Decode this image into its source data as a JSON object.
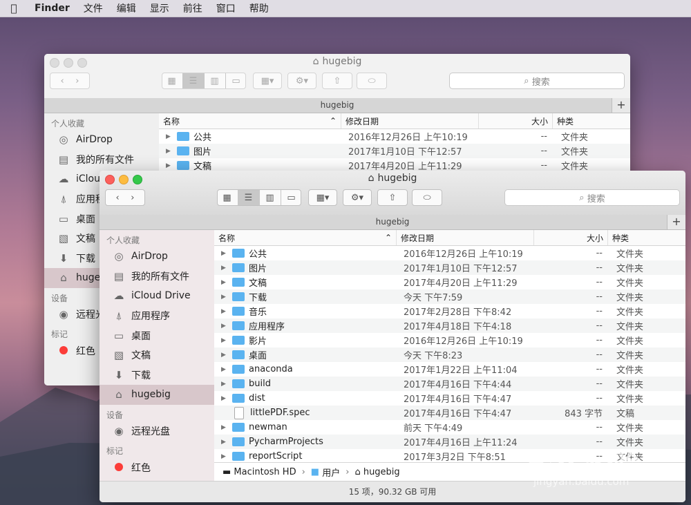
{
  "menubar": {
    "app": "Finder",
    "items": [
      "文件",
      "编辑",
      "显示",
      "前往",
      "窗口",
      "帮助"
    ]
  },
  "window": {
    "title": "hugebig",
    "path_tab": "hugebig",
    "search_placeholder": "搜索",
    "sidebar": {
      "favorites_header": "个人收藏",
      "favorites": [
        {
          "label": "AirDrop",
          "icon": "airdrop-icon"
        },
        {
          "label": "我的所有文件",
          "icon": "all-files-icon"
        },
        {
          "label": "iCloud Drive",
          "icon": "cloud-icon"
        },
        {
          "label": "应用程序",
          "icon": "applications-icon"
        },
        {
          "label": "桌面",
          "icon": "desktop-icon"
        },
        {
          "label": "文稿",
          "icon": "documents-icon"
        },
        {
          "label": "下载",
          "icon": "download-icon"
        },
        {
          "label": "hugebig",
          "icon": "home-icon"
        }
      ],
      "devices_header": "设备",
      "devices": [
        {
          "label": "远程光盘",
          "icon": "disc-icon"
        }
      ],
      "tags_header": "标记",
      "tags": [
        {
          "label": "红色",
          "color": "#fc3d39"
        }
      ]
    },
    "columns": {
      "name": "名称",
      "date": "修改日期",
      "size": "大小",
      "kind": "种类"
    },
    "rows": [
      {
        "name": "公共",
        "date": "2016年12月26日 上午10:19",
        "size": "--",
        "kind": "文件夹"
      },
      {
        "name": "图片",
        "date": "2017年1月10日 下午12:57",
        "size": "--",
        "kind": "文件夹"
      },
      {
        "name": "文稿",
        "date": "2017年4月20日 上午11:29",
        "size": "--",
        "kind": "文件夹"
      },
      {
        "name": "下载",
        "date": "今天 下午7:59",
        "size": "--",
        "kind": "文件夹"
      },
      {
        "name": "音乐",
        "date": "2017年2月28日 下午8:42",
        "size": "--",
        "kind": "文件夹"
      },
      {
        "name": "应用程序",
        "date": "2017年4月18日 下午4:18",
        "size": "--",
        "kind": "文件夹"
      },
      {
        "name": "影片",
        "date": "2016年12月26日 上午10:19",
        "size": "--",
        "kind": "文件夹"
      },
      {
        "name": "桌面",
        "date": "今天 下午8:23",
        "size": "--",
        "kind": "文件夹"
      },
      {
        "name": "anaconda",
        "date": "2017年1月22日 上午11:04",
        "size": "--",
        "kind": "文件夹"
      },
      {
        "name": "build",
        "date": "2017年4月16日 下午4:44",
        "size": "--",
        "kind": "文件夹"
      },
      {
        "name": "dist",
        "date": "2017年4月16日 下午4:47",
        "size": "--",
        "kind": "文件夹"
      },
      {
        "name": "littlePDF.spec",
        "date": "2017年4月16日 下午4:47",
        "size": "843 字节",
        "kind": "文稿",
        "doc": true
      },
      {
        "name": "newman",
        "date": "前天 下午4:49",
        "size": "--",
        "kind": "文件夹"
      },
      {
        "name": "PycharmProjects",
        "date": "2017年4月16日 上午11:24",
        "size": "--",
        "kind": "文件夹"
      },
      {
        "name": "reportScript",
        "date": "2017年3月2日 下午8:51",
        "size": "--",
        "kind": "文件夹"
      }
    ],
    "breadcrumb": [
      "Macintosh HD",
      "用户",
      "hugebig"
    ],
    "status": "15 项，90.32 GB 可用"
  },
  "back_window": {
    "title": "hugebig",
    "sidebar_partial": [
      "AirDrop",
      "我的所有文件",
      "iClou",
      "应用程",
      "桌面",
      "文稿",
      "下载",
      "huge"
    ],
    "devices_partial": "远程光",
    "tags_partial": "红色"
  },
  "watermark": {
    "text": "Bai 经验",
    "sub": "jingyan.baidu.com"
  }
}
